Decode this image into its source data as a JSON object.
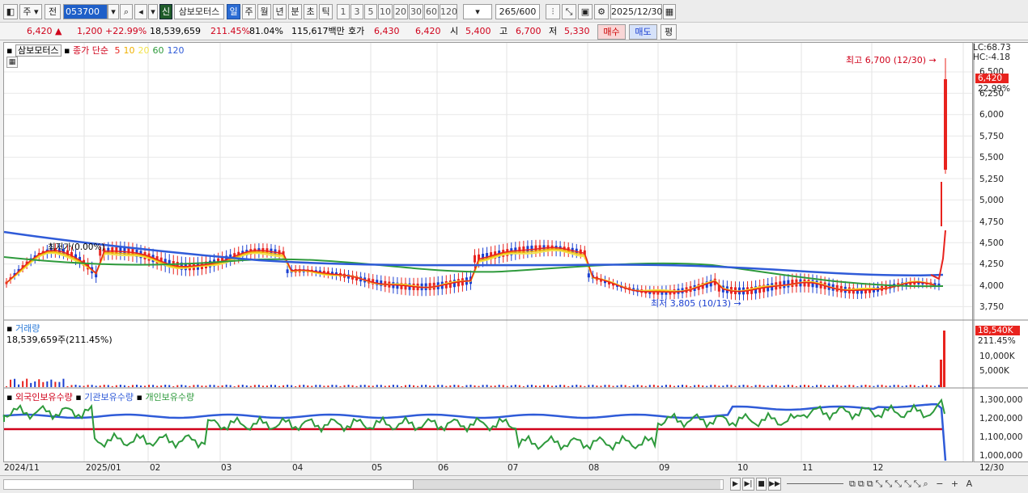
{
  "toolbar": {
    "period_type": "주",
    "prev_label": "전",
    "stock_code": "053700",
    "new_badge": "신",
    "stock_name": "삼보모터스",
    "period_tabs": [
      "일",
      "주",
      "월",
      "년",
      "분",
      "초",
      "틱"
    ],
    "active_period": "일",
    "interval_tabs": [
      "1",
      "3",
      "5",
      "10",
      "20",
      "30",
      "60",
      "120"
    ],
    "count_display": "265",
    "count_total": "/600",
    "date": "2025/12/30"
  },
  "quote": {
    "price": "6,420",
    "change": "1,200",
    "change_pct": "+22.99%",
    "volume": "18,539,659",
    "volume_ratio": "211.45%",
    "strength": "81.04%",
    "trade_value": "115,617백만",
    "ask_label": "호가",
    "ask_price": "6,430",
    "bid_price": "6,420",
    "open_label": "시",
    "open": "5,400",
    "high_label": "고",
    "high": "6,700",
    "low_label": "저",
    "low": "5,330",
    "buy_button": "매수",
    "sell_button": "매도",
    "eval_button": "평"
  },
  "price_panel": {
    "stock_tag": "삼보모터스",
    "ma_label": "종가 단순",
    "ma_periods": [
      "5",
      "10",
      "20",
      "60",
      "120"
    ],
    "ma_colors": [
      "#e8231e",
      "#f0b000",
      "#f2e24a",
      "#2e9a3c",
      "#2f5bd8"
    ],
    "lc": "LC:68.73",
    "hc": "HC:-4.18",
    "high_annotation": "최고 6,700 (12/30)",
    "low_annotation": "최저 3,805 (10/13)",
    "left_label": "최저가(0.00%)",
    "current_price_tag": "6,420",
    "current_pct_tag": "22.99%",
    "y_ticks": [
      "6,500",
      "6,250",
      "6,000",
      "5,750",
      "5,500",
      "5,250",
      "5,000",
      "4,750",
      "4,500",
      "4,250",
      "4,000",
      "3,750"
    ]
  },
  "volume_panel": {
    "title": "거래량",
    "value_text": "18,539,659주(211.45%)",
    "current_tag": "18,540K",
    "pct_tag": "211.45%",
    "y_ticks": [
      "10,000K",
      "5,000K"
    ]
  },
  "holdings_panel": {
    "foreign_label": "외국인보유수량",
    "inst_label": "기관보유수량",
    "indiv_label": "개인보유수량",
    "y_ticks": [
      "1,300,000",
      "1,200,000",
      "1,100,000",
      "1,000,000"
    ]
  },
  "x_axis": [
    "2024/11",
    "2025/01",
    "02",
    "03",
    "04",
    "05",
    "06",
    "07",
    "08",
    "09",
    "10",
    "11",
    "12",
    "12/30"
  ]
}
